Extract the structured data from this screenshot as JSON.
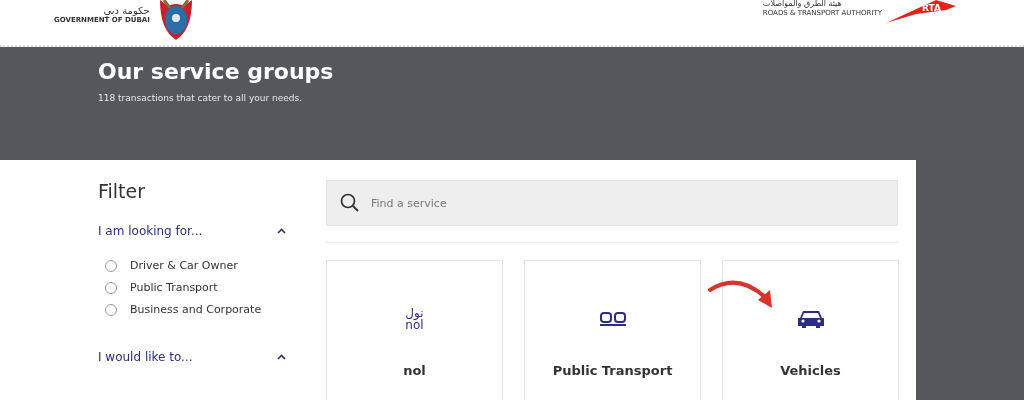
{
  "header": {
    "gov_logo": {
      "arabic": "حكومة دبي",
      "english": "GOVERNMENT OF DUBAI"
    },
    "rta_logo": {
      "arabic": "هيئة الطرق والمواصلات",
      "english": "ROADS & TRANSPORT AUTHORITY",
      "mark": "RTA"
    }
  },
  "hero": {
    "title": "Our service groups",
    "subtitle": "118 transactions that cater to all your needs."
  },
  "filter": {
    "title": "Filter",
    "sections": [
      {
        "label": "I am looking for...",
        "expanded": true,
        "options": [
          {
            "label": "Driver & Car Owner",
            "selected": false
          },
          {
            "label": "Public Transport",
            "selected": false
          },
          {
            "label": "Business and Corporate",
            "selected": false
          }
        ]
      },
      {
        "label": "I would like to...",
        "expanded": true
      }
    ]
  },
  "search": {
    "placeholder": "Find a service"
  },
  "cards": [
    {
      "kind": "nol",
      "title": "nol",
      "logo_text": [
        "نول",
        "nol"
      ]
    },
    {
      "kind": "transport",
      "title": "Public Transport"
    },
    {
      "kind": "vehicle",
      "title": "Vehicles"
    }
  ]
}
